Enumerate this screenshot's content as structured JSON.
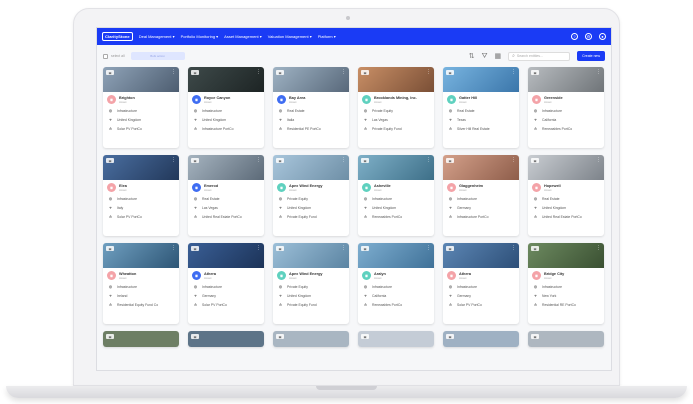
{
  "nav": {
    "logo": "ClarityStone",
    "items": [
      "Deal Management ▾",
      "Portfolio Monitoring ▾",
      "Asset Management ▾",
      "Valuation Management ▾",
      "Platform ▾"
    ],
    "icons": [
      "help-icon",
      "settings-icon",
      "user-icon"
    ]
  },
  "toolbar": {
    "select_all": "select all",
    "bulk_action": "Bulk action",
    "search_placeholder": "Search entities...",
    "create_label": "Create new"
  },
  "colors": {
    "nav_bg": "#1a3bf5",
    "accent": "#1a3bf5"
  },
  "cards": [
    {
      "name": "Brighton",
      "sub": "Asset",
      "avatar": "#f4a3a8",
      "bg": "linear-gradient(135deg,#8fa3b8,#4d5d70)",
      "r1": "Infrastructure",
      "r2": "United Kingdom",
      "r3": "Solar PV PortCo"
    },
    {
      "name": "Royce Canyon",
      "sub": "Asset",
      "avatar": "#3f6df2",
      "bg": "linear-gradient(135deg,#3e4a4a,#1d2424)",
      "r1": "Infrastructure",
      "r2": "United Kingdom",
      "r3": "Infrastructure PortCo"
    },
    {
      "name": "Bay Area",
      "sub": "Asset",
      "avatar": "#3f6df2",
      "bg": "linear-gradient(135deg,#9fb3c4,#58687a)",
      "r1": "Real Estate",
      "r2": "Italia",
      "r3": "Residential PE PortCo"
    },
    {
      "name": "Brooklands Mining, Inc.",
      "sub": "Asset",
      "avatar": "#5fd1bf",
      "bg": "linear-gradient(135deg,#c98f66,#7a4f36)",
      "r1": "Private Equity",
      "r2": "Las Vegas",
      "r3": "Private Equity Fund"
    },
    {
      "name": "Gatter Hill",
      "sub": "Asset",
      "avatar": "#5fd1bf",
      "bg": "linear-gradient(135deg,#78b4e0,#3b76aa)",
      "r1": "Real Estate",
      "r2": "Texas",
      "r3": "Silver Hill Real Estate"
    },
    {
      "name": "Greenside",
      "sub": "Asset",
      "avatar": "#f4a3a8",
      "bg": "linear-gradient(135deg,#b8bcc0,#6f7478)",
      "r1": "Infrastructure",
      "r2": "California",
      "r3": "Renewables PortCo"
    },
    {
      "name": "Elea",
      "sub": "Asset",
      "avatar": "#f4a3a8",
      "bg": "linear-gradient(135deg,#4a6ea0,#22385a)",
      "r1": "Infrastructure",
      "r2": "Italy",
      "r3": "Solar PV PortCo"
    },
    {
      "name": "Emerod",
      "sub": "Asset",
      "avatar": "#3f6df2",
      "bg": "linear-gradient(135deg,#a6b4c0,#5c6a78)",
      "r1": "Real Estate",
      "r2": "Las Vegas",
      "r3": "United Real Estate PortCo"
    },
    {
      "name": "Apex Wind Energy",
      "sub": "Asset",
      "avatar": "#5fd1bf",
      "bg": "linear-gradient(135deg,#a9c6dc,#6e8fa6)",
      "r1": "Private Equity",
      "r2": "United Kingdom",
      "r3": "Private Equity Fund"
    },
    {
      "name": "Asheville",
      "sub": "Asset",
      "avatar": "#5fd1bf",
      "bg": "linear-gradient(135deg,#7fb0c8,#3d6f88)",
      "r1": "Infrastructure",
      "r2": "United Kingdom",
      "r3": "Renewables PortCo"
    },
    {
      "name": "Glaggenheim",
      "sub": "Asset",
      "avatar": "#f4a3a8",
      "bg": "linear-gradient(135deg,#d4a08a,#8e5d4a)",
      "r1": "Infrastructure",
      "r2": "Germany",
      "r3": "Infrastructure PortCo"
    },
    {
      "name": "Hopewell",
      "sub": "Asset",
      "avatar": "#f4a3a8",
      "bg": "linear-gradient(135deg,#c9cdd2,#7d838a)",
      "r1": "Real Estate",
      "r2": "United Kingdom",
      "r3": "United Real Estate PortCo"
    },
    {
      "name": "Wheatton",
      "sub": "Asset",
      "avatar": "#f4a3a8",
      "bg": "linear-gradient(135deg,#6f9fc0,#2d5575)",
      "r1": "Infrastructure",
      "r2": "Ireland",
      "r3": "Residential Equity Fund Co"
    },
    {
      "name": "Athera",
      "sub": "Asset",
      "avatar": "#3f6df2",
      "bg": "linear-gradient(135deg,#3a5f96,#1c3358)",
      "r1": "Infrastructure",
      "r2": "Germany",
      "r3": "Solar PV PortCo"
    },
    {
      "name": "Apex Wind Energy",
      "sub": "Asset",
      "avatar": "#5fd1bf",
      "bg": "linear-gradient(135deg,#9cbfd8,#5b84a2)",
      "r1": "Private Equity",
      "r2": "United Kingdom",
      "r3": "Private Equity Fund"
    },
    {
      "name": "Aralyn",
      "sub": "Asset",
      "avatar": "#5fd1bf",
      "bg": "linear-gradient(135deg,#7eaed0,#3f7198)",
      "r1": "Infrastructure",
      "r2": "California",
      "r3": "Renewables PortCo"
    },
    {
      "name": "Athera",
      "sub": "Asset",
      "avatar": "#f4a3a8",
      "bg": "linear-gradient(135deg,#5c86b4,#2d4f78)",
      "r1": "Infrastructure",
      "r2": "Germany",
      "r3": "Solar PV PortCo"
    },
    {
      "name": "Bridge City",
      "sub": "Asset",
      "avatar": "#f4a3a8",
      "bg": "linear-gradient(135deg,#6d8a60,#3a5032)",
      "r1": "Infrastructure",
      "r2": "New York",
      "r3": "Residential RE PortCo"
    }
  ],
  "partial_bgs": [
    "#6d7e64",
    "#5d7488",
    "#a9b6c2",
    "#c4ccd6",
    "#9fb1c3",
    "#aeb7c0"
  ]
}
